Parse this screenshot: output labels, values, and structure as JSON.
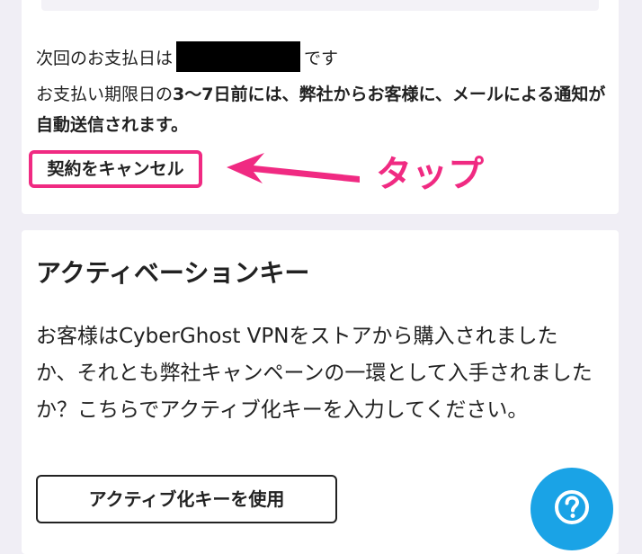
{
  "billing": {
    "next_payment_prefix": "次回のお支払日は",
    "next_payment_suffix": "です",
    "notice_prefix": "お支払い期限日の",
    "notice_bold": "3〜7日前には、弊社からお客様に、メールによる通知が自動送信されます。",
    "cancel_label": "契約をキャンセル"
  },
  "annotation": {
    "tap_label": "タップ",
    "color": "#f02a82"
  },
  "activation": {
    "title": "アクティベーションキー",
    "description": "お客様はCyberGhost VPNをストアから購入されましたか、それとも弊社キャンペーンの一環として入手されましたか？こちらでアクティブ化キーを入力してください。",
    "button_label": "アクティブ化キーを使用"
  },
  "help": {
    "icon": "question-mark-icon",
    "color": "#1aa3e6"
  },
  "colors": {
    "background": "#f0eef5",
    "card": "#ffffff",
    "text": "#222222"
  }
}
